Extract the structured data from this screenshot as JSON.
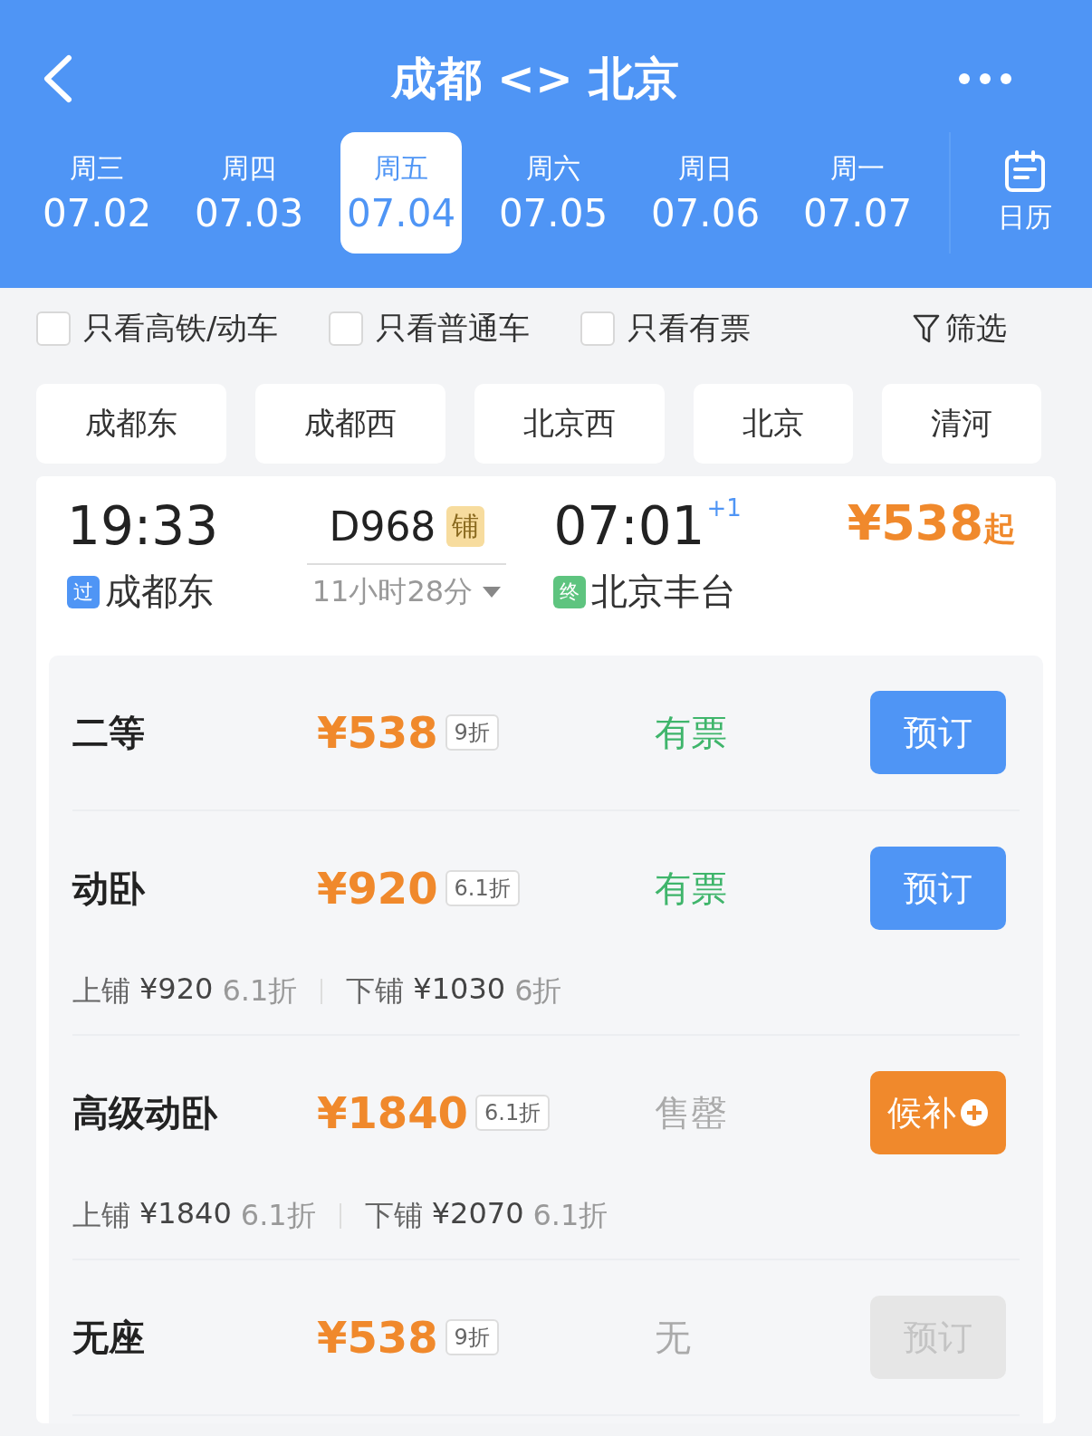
{
  "header": {
    "title": "成都 <> 北京"
  },
  "dates": [
    {
      "weekday": "周三",
      "date": "07.02",
      "selected": false
    },
    {
      "weekday": "周四",
      "date": "07.03",
      "selected": false
    },
    {
      "weekday": "周五",
      "date": "07.04",
      "selected": true
    },
    {
      "weekday": "周六",
      "date": "07.05",
      "selected": false
    },
    {
      "weekday": "周日",
      "date": "07.06",
      "selected": false
    },
    {
      "weekday": "周一",
      "date": "07.07",
      "selected": false
    }
  ],
  "calendar": {
    "label": "日历"
  },
  "filters": [
    {
      "label": "只看高铁/动车",
      "checked": false
    },
    {
      "label": "只看普通车",
      "checked": false
    },
    {
      "label": "只看有票",
      "checked": false
    }
  ],
  "filter_button": {
    "label": "筛选"
  },
  "stations": [
    "成都东",
    "成都西",
    "北京西",
    "北京",
    "清河"
  ],
  "train": {
    "depart_time": "19:33",
    "depart_tag": "过",
    "depart_station": "成都东",
    "number": "D968",
    "number_badge": "铺",
    "duration": "11小时28分",
    "arrive_time": "07:01",
    "arrive_offset": "+1",
    "arrive_tag": "终",
    "arrive_station": "北京丰台",
    "price": "¥538",
    "price_suffix": "起"
  },
  "seats": [
    {
      "name": "二等",
      "price": "¥538",
      "discount": "9折",
      "availability": "有票",
      "available": true,
      "button": {
        "label": "预订",
        "kind": "book"
      }
    },
    {
      "name": "动卧",
      "price": "¥920",
      "discount": "6.1折",
      "availability": "有票",
      "available": true,
      "button": {
        "label": "预订",
        "kind": "book"
      },
      "details": [
        {
          "label": "上铺",
          "price": "¥920",
          "discount": "6.1折"
        },
        {
          "label": "下铺",
          "price": "¥1030",
          "discount": "6折"
        }
      ]
    },
    {
      "name": "高级动卧",
      "price": "¥1840",
      "discount": "6.1折",
      "availability": "售罄",
      "available": false,
      "button": {
        "label": "候补",
        "kind": "waitlist"
      },
      "details": [
        {
          "label": "上铺",
          "price": "¥1840",
          "discount": "6.1折"
        },
        {
          "label": "下铺",
          "price": "¥2070",
          "discount": "6.1折"
        }
      ]
    },
    {
      "name": "无座",
      "price": "¥538",
      "discount": "9折",
      "availability": "无",
      "available": false,
      "button": {
        "label": "预订",
        "kind": "disabled"
      }
    }
  ]
}
